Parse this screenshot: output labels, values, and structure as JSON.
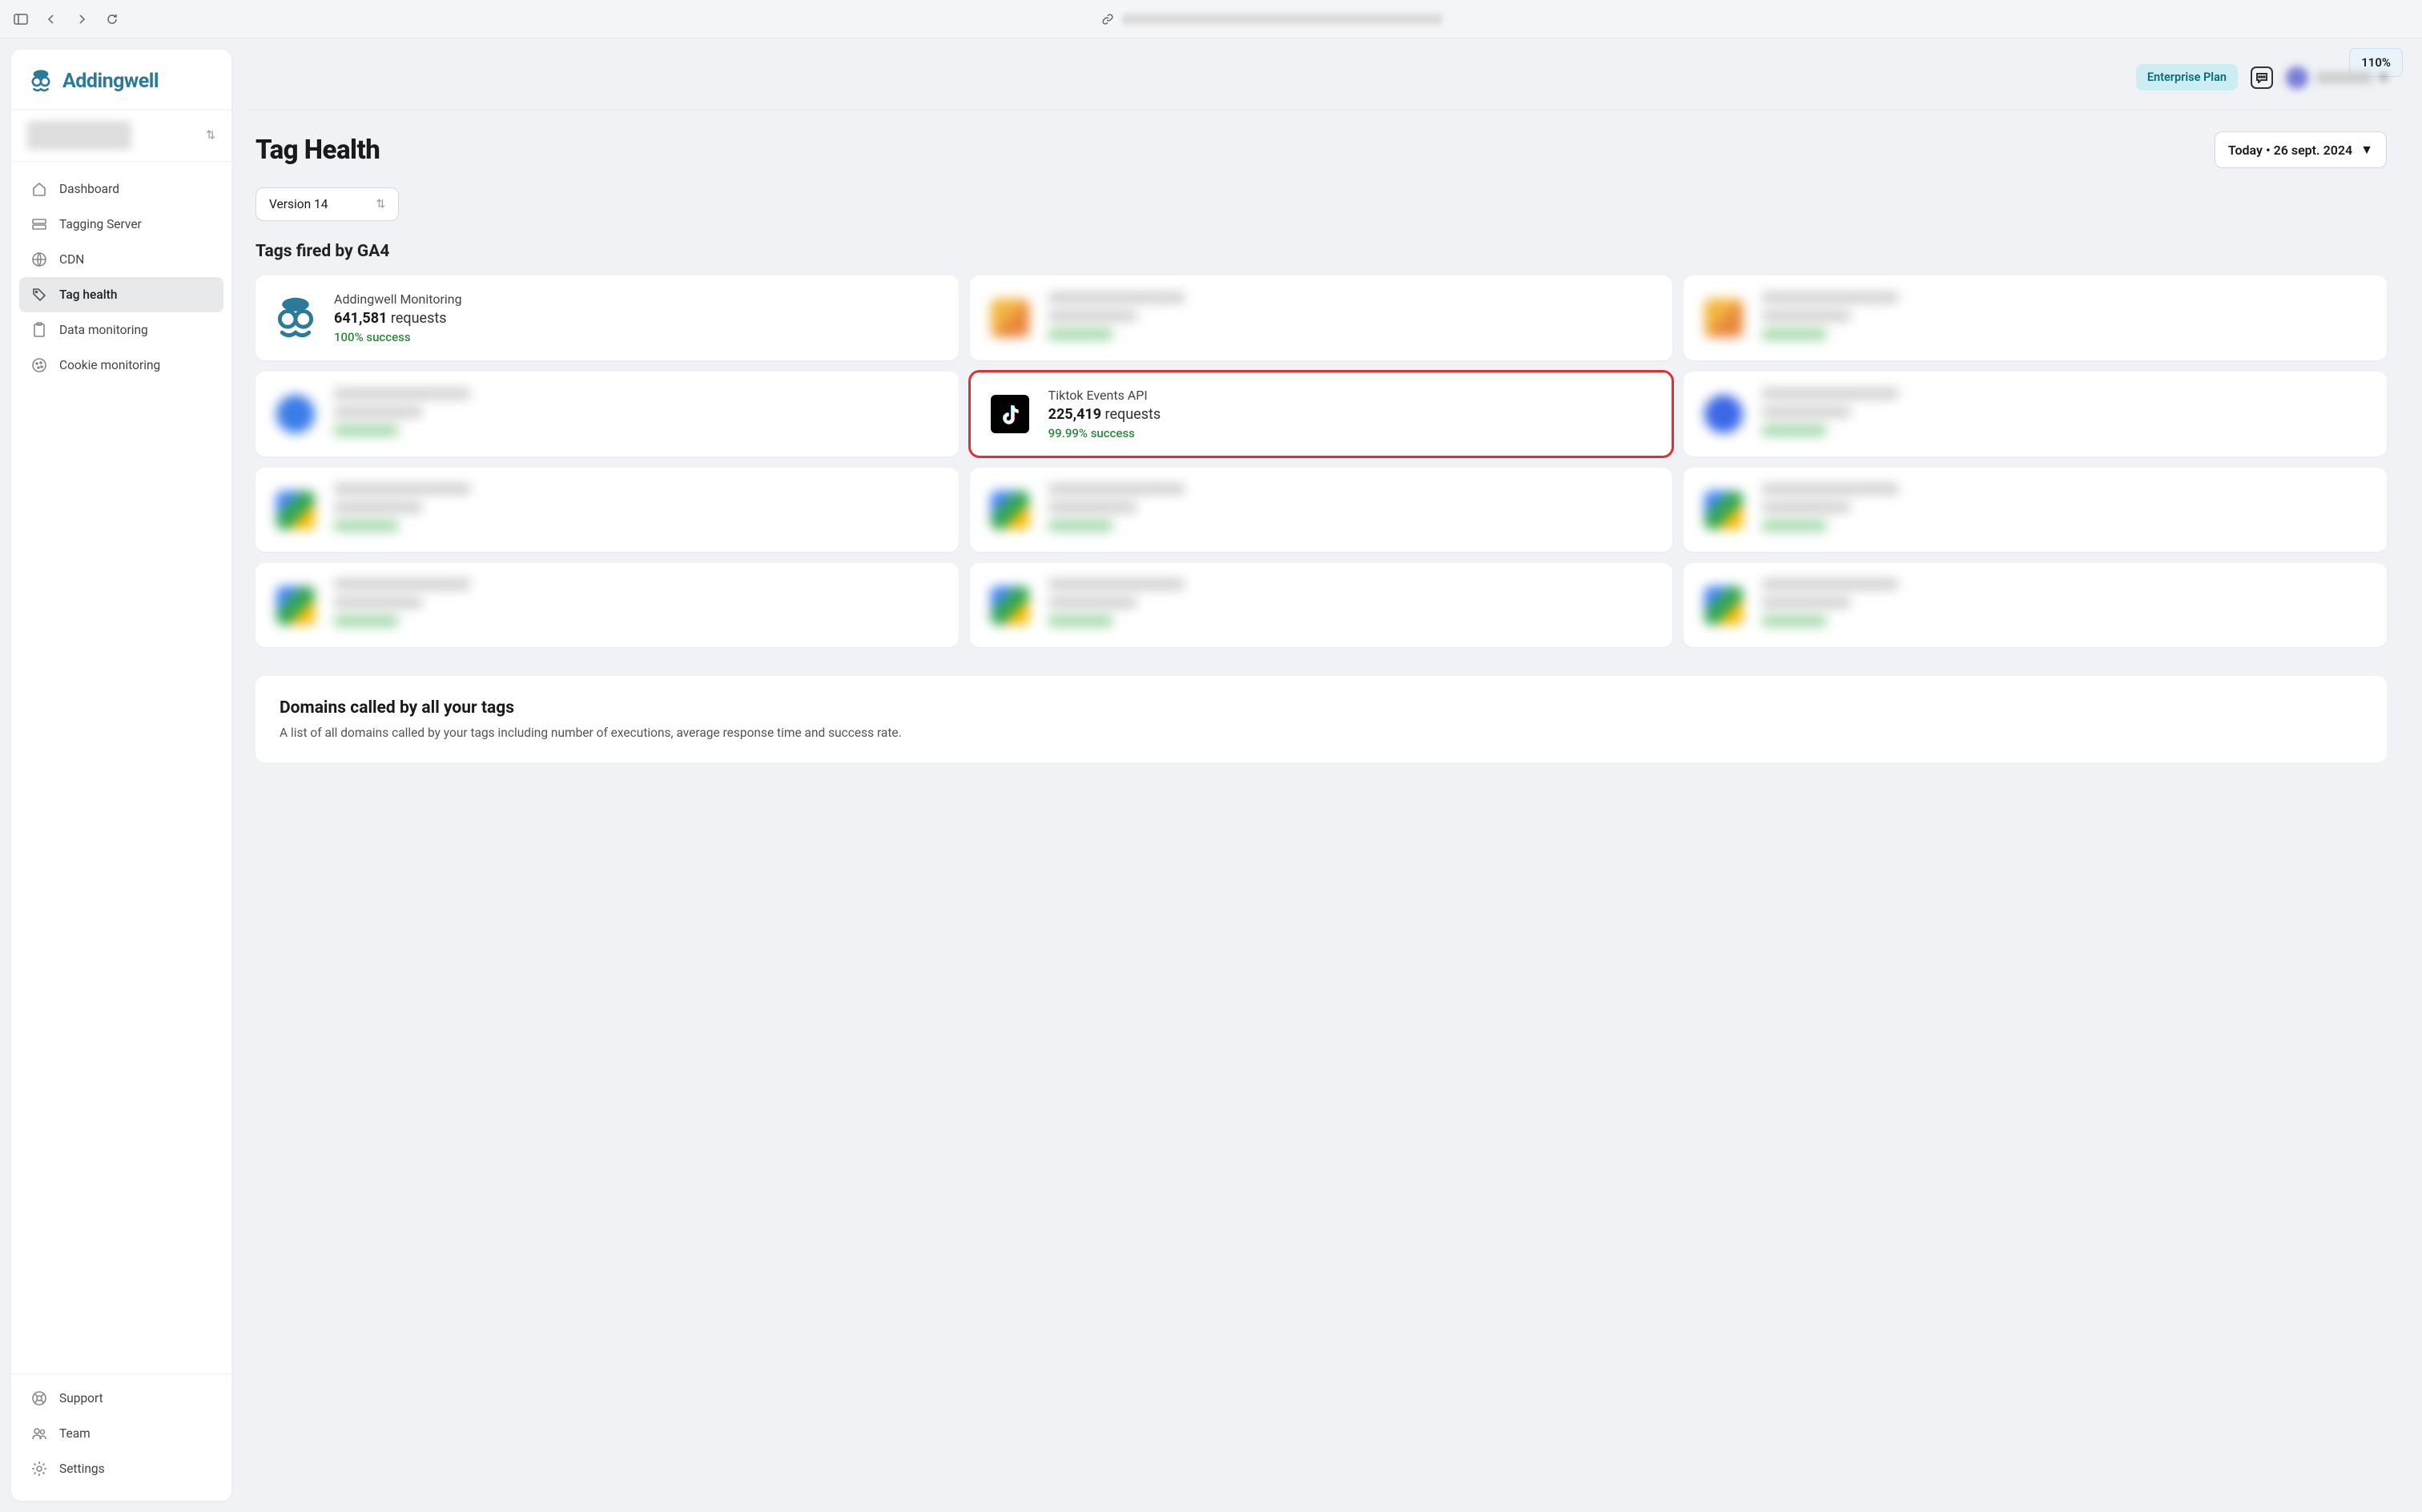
{
  "chrome": {
    "zoom": "110%"
  },
  "brand": {
    "name": "Addingwell"
  },
  "topbar": {
    "plan": "Enterprise Plan"
  },
  "sidebar": {
    "items": [
      {
        "label": "Dashboard"
      },
      {
        "label": "Tagging Server"
      },
      {
        "label": "CDN"
      },
      {
        "label": "Tag health"
      },
      {
        "label": "Data monitoring"
      },
      {
        "label": "Cookie monitoring"
      }
    ],
    "bottom": [
      {
        "label": "Support"
      },
      {
        "label": "Team"
      },
      {
        "label": "Settings"
      }
    ]
  },
  "page": {
    "title": "Tag Health",
    "date_label": "Today • 26 sept. 2024",
    "version": "Version 14",
    "section_title": "Tags fired by GA4"
  },
  "cards": {
    "addingwell": {
      "title": "Addingwell Monitoring",
      "requests_count": "641,581",
      "requests_label": "requests",
      "success": "100% success"
    },
    "tiktok": {
      "title": "Tiktok Events API",
      "requests_count": "225,419",
      "requests_label": "requests",
      "success": "99.99% success"
    }
  },
  "domains": {
    "title": "Domains called by all your tags",
    "description": "A list of all domains called by your tags including number of executions, average response time and success rate."
  }
}
